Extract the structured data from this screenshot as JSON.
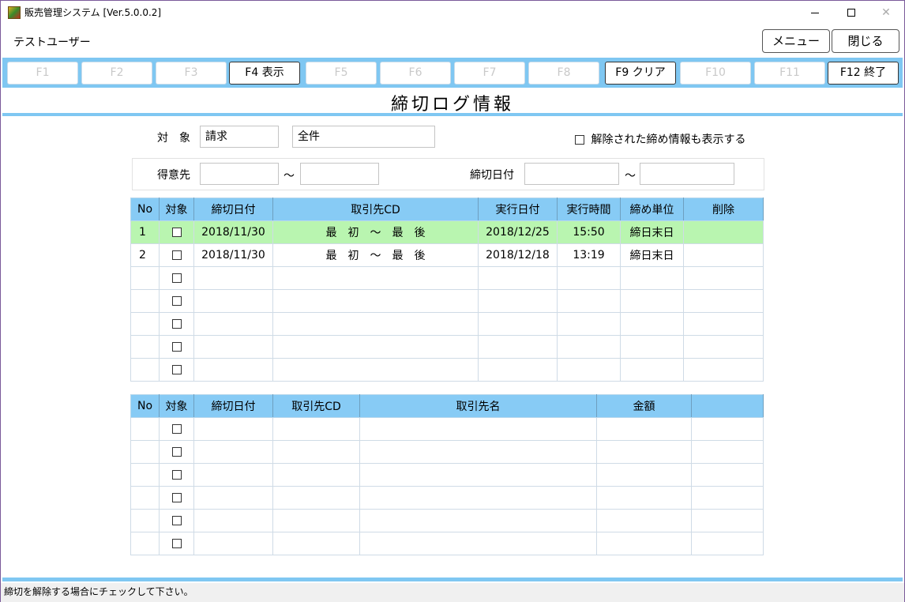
{
  "window": {
    "title": "販売管理システム [Ver.5.0.0.2]",
    "min_label": "",
    "max_label": "",
    "close_label": "✕"
  },
  "user": {
    "name": "テストユーザー"
  },
  "top_buttons": {
    "menu": "メニュー",
    "close": "閉じる"
  },
  "fkeys": [
    {
      "label": "F1",
      "active": false
    },
    {
      "label": "F2",
      "active": false
    },
    {
      "label": "F3",
      "active": false
    },
    {
      "label": "F4 表示",
      "active": true
    },
    {
      "label": "F5",
      "active": false
    },
    {
      "label": "F6",
      "active": false
    },
    {
      "label": "F7",
      "active": false
    },
    {
      "label": "F8",
      "active": false
    },
    {
      "label": "F9 クリア",
      "active": true
    },
    {
      "label": "F10",
      "active": false
    },
    {
      "label": "F11",
      "active": false
    },
    {
      "label": "F12 終了",
      "active": true
    }
  ],
  "screen_title": "締切ログ情報",
  "filters": {
    "target_label": "対　象",
    "target_value": "請求",
    "scope_value": "全件",
    "show_released_label": "解除された締め情報も表示する",
    "customer_label": "得意先",
    "customer_from": "",
    "customer_to": "",
    "tilde": "～",
    "cutoff_label": "締切日付",
    "cutoff_from": "",
    "cutoff_to": ""
  },
  "log_table": {
    "headers": [
      "No",
      "対象",
      "締切日付",
      "取引先CD",
      "実行日付",
      "実行時間",
      "締め単位",
      "削除"
    ],
    "rows": [
      {
        "no": "1",
        "date": "2018/11/30",
        "range": "最　初　～　最　後",
        "exec_date": "2018/12/25",
        "exec_time": "15:50",
        "unit": "締日末日",
        "del": "",
        "selected": true
      },
      {
        "no": "2",
        "date": "2018/11/30",
        "range": "最　初　～　最　後",
        "exec_date": "2018/12/18",
        "exec_time": "13:19",
        "unit": "締日末日",
        "del": "",
        "selected": false
      },
      {
        "no": "",
        "date": "",
        "range": "",
        "exec_date": "",
        "exec_time": "",
        "unit": "",
        "del": "",
        "selected": false
      },
      {
        "no": "",
        "date": "",
        "range": "",
        "exec_date": "",
        "exec_time": "",
        "unit": "",
        "del": "",
        "selected": false
      },
      {
        "no": "",
        "date": "",
        "range": "",
        "exec_date": "",
        "exec_time": "",
        "unit": "",
        "del": "",
        "selected": false
      },
      {
        "no": "",
        "date": "",
        "range": "",
        "exec_date": "",
        "exec_time": "",
        "unit": "",
        "del": "",
        "selected": false
      },
      {
        "no": "",
        "date": "",
        "range": "",
        "exec_date": "",
        "exec_time": "",
        "unit": "",
        "del": "",
        "selected": false
      }
    ]
  },
  "detail_table": {
    "headers": [
      "No",
      "対象",
      "締切日付",
      "取引先CD",
      "取引先名",
      "金額",
      ""
    ],
    "rows": [
      {
        "no": "",
        "date": "",
        "cd": "",
        "name": "",
        "amount": "",
        "extra": ""
      },
      {
        "no": "",
        "date": "",
        "cd": "",
        "name": "",
        "amount": "",
        "extra": ""
      },
      {
        "no": "",
        "date": "",
        "cd": "",
        "name": "",
        "amount": "",
        "extra": ""
      },
      {
        "no": "",
        "date": "",
        "cd": "",
        "name": "",
        "amount": "",
        "extra": ""
      },
      {
        "no": "",
        "date": "",
        "cd": "",
        "name": "",
        "amount": "",
        "extra": ""
      },
      {
        "no": "",
        "date": "",
        "cd": "",
        "name": "",
        "amount": "",
        "extra": ""
      }
    ]
  },
  "status_text": "締切を解除する場合にチェックして下さい。",
  "colors": {
    "accent": "#7fc7f2",
    "header": "#87cbf5",
    "selected_row": "#b9f5b0"
  }
}
